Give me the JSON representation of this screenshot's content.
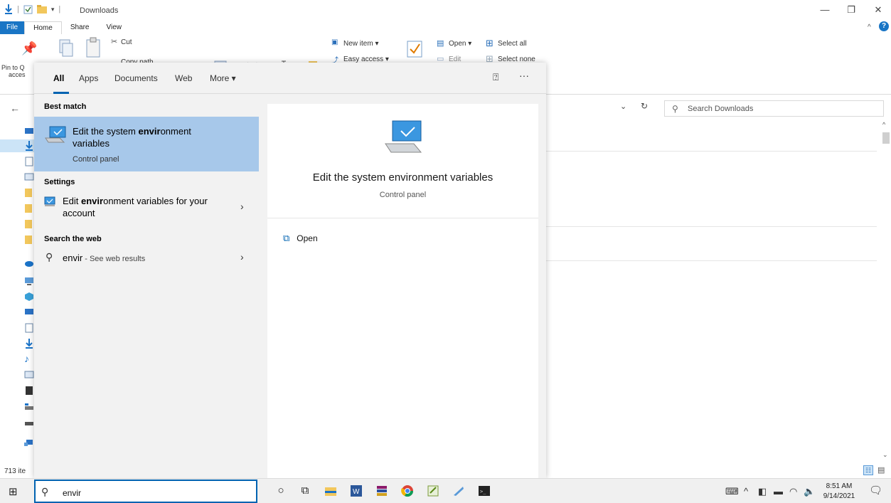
{
  "window": {
    "title": "Downloads"
  },
  "ribbon": {
    "tabs": [
      "File",
      "Home",
      "Share",
      "View"
    ],
    "pin_label_1": "Pin to Q",
    "pin_label_2": "acces",
    "cut": "Cut",
    "copy_path": "Copy path",
    "new_item": "New item ▾",
    "easy_access": "Easy access ▾",
    "open": "Open ▾",
    "edit": "Edit",
    "select_all": "Select all",
    "select_none": "Select none"
  },
  "explorer": {
    "search_placeholder": "Search Downloads",
    "item_count": "713 ite"
  },
  "flyout": {
    "tabs": [
      "All",
      "Apps",
      "Documents",
      "Web",
      "More ▾"
    ],
    "sections": {
      "best_match": "Best match",
      "settings": "Settings",
      "search_web": "Search the web"
    },
    "best_result": {
      "title_pre": "Edit the system ",
      "title_bold": "envir",
      "title_post": "onment",
      "title_line2": "variables",
      "subtitle": "Control panel"
    },
    "settings_result": {
      "title_pre": "Edit ",
      "title_bold": "envir",
      "title_post": "onment variables for your",
      "title_line2": "account"
    },
    "web_result": {
      "query": "envir",
      "suffix": " - See web results"
    },
    "detail": {
      "title": "Edit the system environment variables",
      "subtitle": "Control panel",
      "open_label": "Open"
    }
  },
  "taskbar": {
    "search_value": "envir",
    "time": "8:51 AM",
    "date": "9/14/2021"
  },
  "colors": {
    "accent": "#0063b1",
    "selection": "#a7c8ea",
    "file_tab": "#1975c5"
  }
}
